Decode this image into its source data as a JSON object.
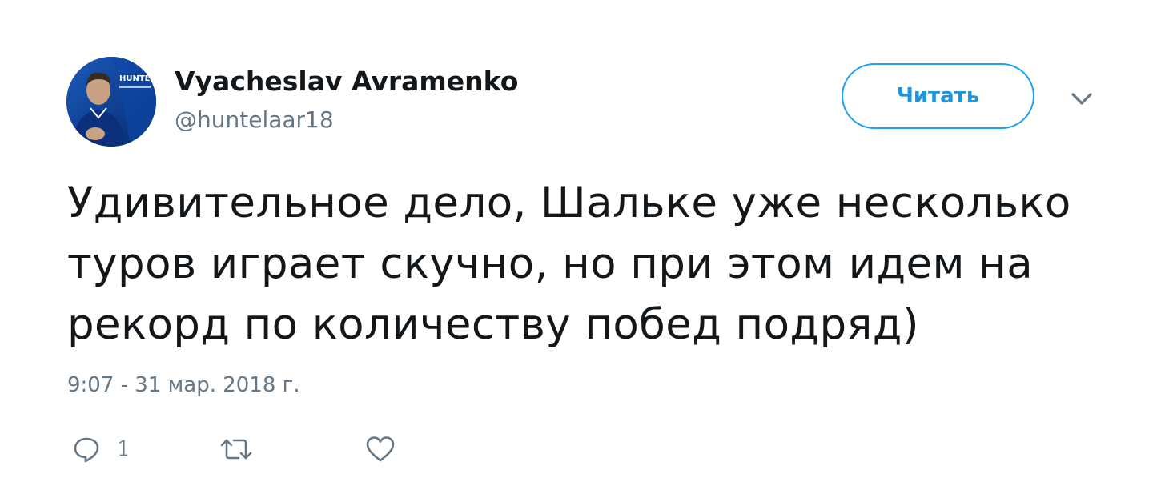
{
  "author": {
    "display_name": "Vyacheslav Avramenko",
    "handle": "@huntelaar18",
    "avatar_banner_text": "HUNTELAAR"
  },
  "follow_button": {
    "label": "Читать"
  },
  "tweet": {
    "text": "Удивительное дело, Шальке уже несколько туров играет скучно, но при этом идем на рекорд по количеству побед подряд)",
    "timestamp": "9:07 - 31 мар. 2018 г."
  },
  "actions": {
    "reply": {
      "icon": "reply-icon",
      "count": "1"
    },
    "retweet": {
      "icon": "retweet-icon"
    },
    "like": {
      "icon": "heart-icon"
    }
  },
  "colors": {
    "text": "#14171a",
    "secondary": "#657786",
    "accent": "#1da1f2",
    "accent_text": "#1b95e0"
  }
}
